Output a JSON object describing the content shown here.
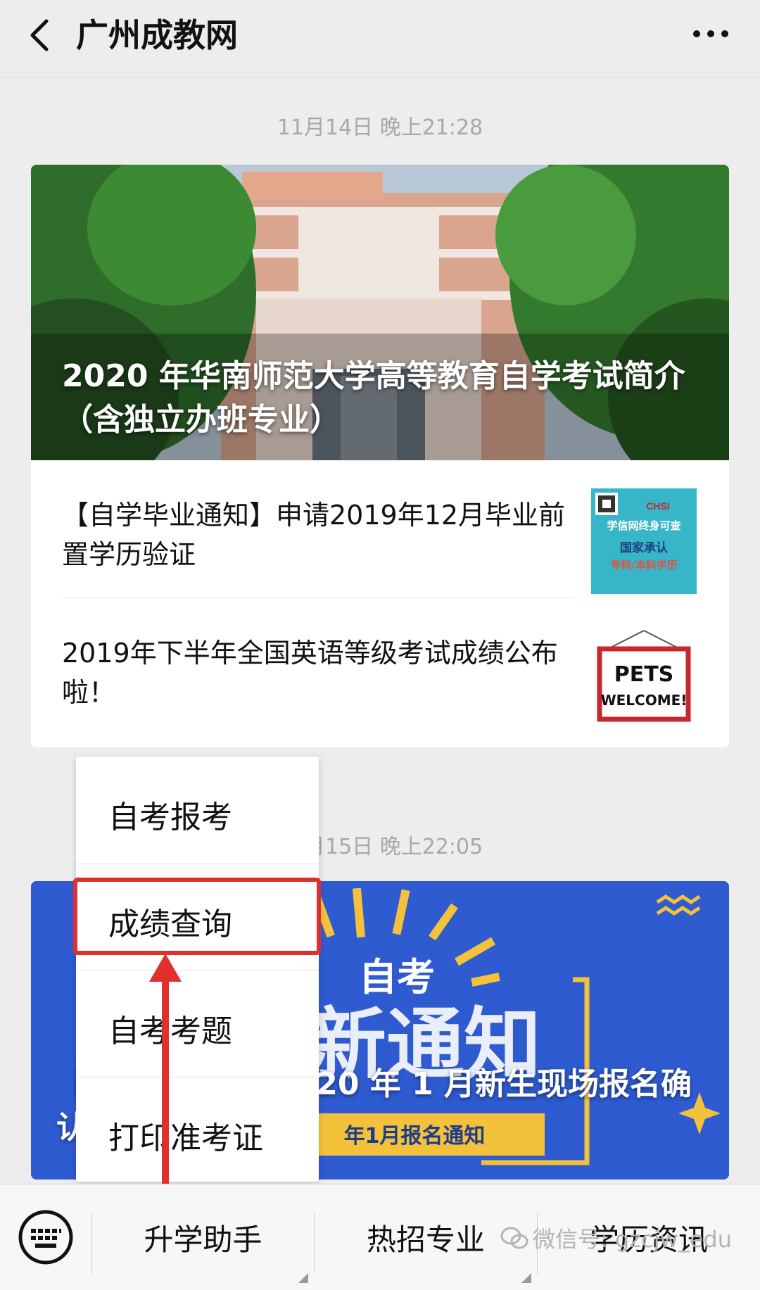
{
  "header": {
    "title": "广州成教网"
  },
  "articles": [
    {
      "timestamp": "11月14日 晚上21:28",
      "cover_title": "2020 年华南师范大学高等教育自学考试简介（含独立办班专业）",
      "sub_items": [
        {
          "title": "【自学毕业通知】申请2019年12月毕业前置学历验证",
          "thumb_text": [
            "学信网终身可查",
            "国家承认",
            "专科/本科学历"
          ],
          "thumb_logo": "CHSI"
        },
        {
          "title": "2019年下半年全国英语等级考试成绩公布啦！",
          "thumb_text": [
            "PETS",
            "WELCOME!"
          ]
        }
      ]
    },
    {
      "timestamp": "11月15日 晚上22:05",
      "cover_title": "【自考新通知】2020 年 1 月新生现场报名确认",
      "banner_text": [
        "自考",
        "新通知",
        "年1月报名通知"
      ]
    }
  ],
  "popup_menu": {
    "items": [
      "自考报考",
      "成绩查询",
      "自考考题",
      "打印准考证"
    ],
    "highlighted": "成绩查询"
  },
  "bottom_bar": {
    "tabs": [
      "升学助手",
      "热招专业",
      "学历资讯"
    ]
  },
  "watermark": "微信号: gzcjw_edu",
  "colors": {
    "highlight": "#e0302e",
    "banner_blue": "#2e5bd0",
    "banner_yellow": "#f3c13a"
  }
}
